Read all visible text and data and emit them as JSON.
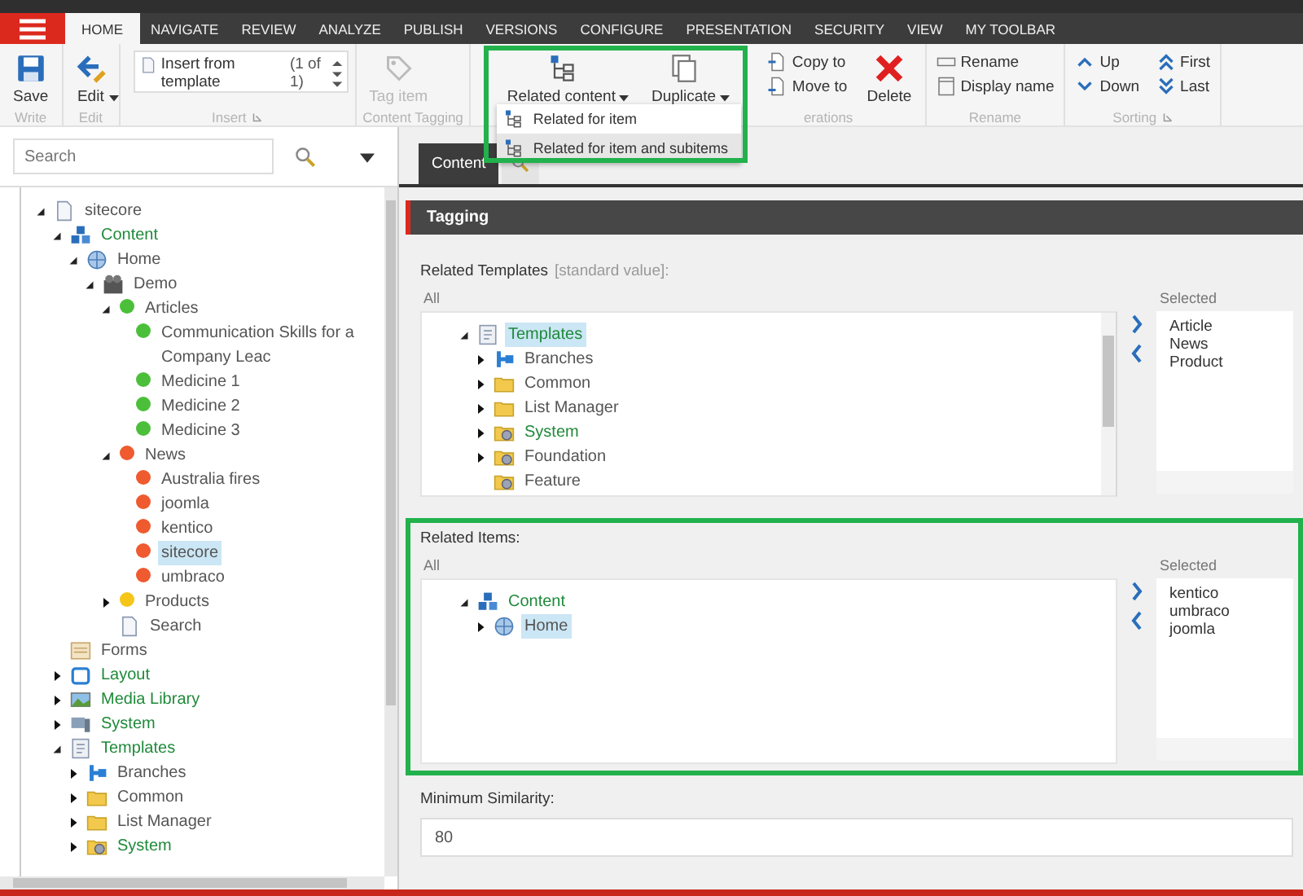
{
  "ribbon_tabs": [
    {
      "label": "HOME",
      "selected": true
    },
    {
      "label": "NAVIGATE",
      "selected": false
    },
    {
      "label": "REVIEW",
      "selected": false
    },
    {
      "label": "ANALYZE",
      "selected": false
    },
    {
      "label": "PUBLISH",
      "selected": false
    },
    {
      "label": "VERSIONS",
      "selected": false
    },
    {
      "label": "CONFIGURE",
      "selected": false
    },
    {
      "label": "PRESENTATION",
      "selected": false
    },
    {
      "label": "SECURITY",
      "selected": false
    },
    {
      "label": "VIEW",
      "selected": false
    },
    {
      "label": "MY TOOLBAR",
      "selected": false
    }
  ],
  "ribbon_groups": [
    {
      "label": "Write",
      "launcher": false,
      "items": [
        {
          "kind": "large",
          "label": "Save",
          "dropdown": false,
          "disabled": false
        }
      ]
    },
    {
      "label": "Edit",
      "launcher": false,
      "items": [
        {
          "kind": "large",
          "label": "Edit",
          "dropdown": true,
          "disabled": false
        }
      ]
    },
    {
      "label": "Insert",
      "launcher": true,
      "items": [
        {
          "kind": "gallery",
          "label": "Insert from template",
          "count": "(1 of 1)"
        }
      ]
    },
    {
      "label": "Content Tagging",
      "launcher": false,
      "items": [
        {
          "kind": "large",
          "label": "Tag item",
          "dropdown": false,
          "disabled": true
        }
      ]
    },
    {
      "label": "erations",
      "launcher": false,
      "items": [
        {
          "kind": "frame",
          "highlighted": true,
          "items": [
            {
              "kind": "large",
              "label": "Related content",
              "dropdown": true,
              "disabled": false
            },
            {
              "kind": "large",
              "label": "Duplicate",
              "dropdown": true,
              "disabled": false
            }
          ],
          "menu": [
            {
              "label": "Related for item",
              "hovered": false
            },
            {
              "label": "Related for item and subitems",
              "hovered": true
            }
          ]
        },
        {
          "kind": "stack",
          "items": [
            {
              "label": "Copy to"
            },
            {
              "label": "Move to"
            }
          ]
        },
        {
          "kind": "large",
          "label": "Delete",
          "dropdown": false,
          "disabled": false
        }
      ]
    },
    {
      "label": "Rename",
      "launcher": false,
      "items": [
        {
          "kind": "stack",
          "items": [
            {
              "label": "Rename"
            },
            {
              "label": "Display name"
            }
          ]
        }
      ]
    },
    {
      "label": "Sorting",
      "launcher": true,
      "items": [
        {
          "kind": "stack",
          "items": [
            {
              "label": "Up"
            },
            {
              "label": "Down"
            }
          ]
        },
        {
          "kind": "stack",
          "items": [
            {
              "label": "First"
            },
            {
              "label": "Last"
            }
          ]
        }
      ]
    }
  ],
  "search": {
    "placeholder": "Search"
  },
  "tree": [
    {
      "label": "sitecore",
      "kind": "document",
      "expanded": true,
      "emphasis": false,
      "selected": false,
      "children": [
        {
          "label": "Content",
          "kind": "cubes",
          "expanded": true,
          "emphasis": true,
          "selected": false,
          "children": [
            {
              "label": "Home",
              "kind": "globe",
              "expanded": true,
              "emphasis": false,
              "selected": false,
              "children": [
                {
                  "label": "Demo",
                  "kind": "camera",
                  "expanded": true,
                  "emphasis": false,
                  "selected": false,
                  "children": [
                    {
                      "label": "Articles",
                      "kind": "dot",
                      "color": "#4cbf3a",
                      "expanded": true,
                      "emphasis": false,
                      "selected": false,
                      "children": [
                        {
                          "label": "Communication Skills for a Company Leac",
                          "kind": "dot",
                          "color": "#4cbf3a",
                          "emphasis": false,
                          "selected": false
                        },
                        {
                          "label": "Medicine 1",
                          "kind": "dot",
                          "color": "#4cbf3a",
                          "emphasis": false,
                          "selected": false
                        },
                        {
                          "label": "Medicine 2",
                          "kind": "dot",
                          "color": "#4cbf3a",
                          "emphasis": false,
                          "selected": false
                        },
                        {
                          "label": "Medicine 3",
                          "kind": "dot",
                          "color": "#4cbf3a",
                          "emphasis": false,
                          "selected": false
                        }
                      ]
                    },
                    {
                      "label": "News",
                      "kind": "dot",
                      "color": "#ef5a2f",
                      "expanded": true,
                      "emphasis": false,
                      "selected": false,
                      "children": [
                        {
                          "label": "Australia fires",
                          "kind": "dot",
                          "color": "#ef5a2f",
                          "emphasis": false,
                          "selected": false
                        },
                        {
                          "label": "joomla",
                          "kind": "dot",
                          "color": "#ef5a2f",
                          "emphasis": false,
                          "selected": false
                        },
                        {
                          "label": "kentico",
                          "kind": "dot",
                          "color": "#ef5a2f",
                          "emphasis": false,
                          "selected": false
                        },
                        {
                          "label": "sitecore",
                          "kind": "dot",
                          "color": "#ef5a2f",
                          "emphasis": false,
                          "selected": true
                        },
                        {
                          "label": "umbraco",
                          "kind": "dot",
                          "color": "#ef5a2f",
                          "emphasis": false,
                          "selected": false
                        }
                      ]
                    },
                    {
                      "label": "Products",
                      "kind": "dot",
                      "color": "#f5c518",
                      "expanded": false,
                      "emphasis": false,
                      "selected": false
                    },
                    {
                      "label": "Search",
                      "kind": "document",
                      "emphasis": false,
                      "selected": false
                    }
                  ]
                }
              ]
            }
          ]
        },
        {
          "label": "Forms",
          "kind": "forms",
          "emphasis": false,
          "selected": false
        },
        {
          "label": "Layout",
          "kind": "window",
          "expanded": false,
          "emphasis": true,
          "selected": false
        },
        {
          "label": "Media Library",
          "kind": "picture",
          "expanded": false,
          "emphasis": true,
          "selected": false
        },
        {
          "label": "System",
          "kind": "computer",
          "expanded": false,
          "emphasis": true,
          "selected": false
        },
        {
          "label": "Templates",
          "kind": "templates",
          "expanded": true,
          "emphasis": true,
          "selected": false,
          "children": [
            {
              "label": "Branches",
              "kind": "branches",
              "expanded": false,
              "emphasis": false,
              "selected": false
            },
            {
              "label": "Common",
              "kind": "folder",
              "expanded": false,
              "emphasis": false,
              "selected": false
            },
            {
              "label": "List Manager",
              "kind": "folder",
              "expanded": false,
              "emphasis": false,
              "selected": false
            },
            {
              "label": "System",
              "kind": "gearfolder",
              "expanded": false,
              "emphasis": true,
              "selected": false
            }
          ]
        }
      ]
    }
  ],
  "editor_tabs": [
    {
      "kind": "text",
      "label": "Content",
      "selected": true
    },
    {
      "kind": "search",
      "selected": false
    }
  ],
  "section": {
    "title": "Tagging",
    "fields": [
      {
        "kind": "treelist",
        "label": "Related Templates",
        "note": "[standard value]:",
        "highlighted": false,
        "all_label": "All",
        "selected_label": "Selected",
        "scrollable": true,
        "tree": [
          {
            "label": "Templates",
            "kind": "templates",
            "expanded": true,
            "emphasis": true,
            "selected": true,
            "children": [
              {
                "label": "Branches",
                "kind": "branches",
                "expanded": false,
                "emphasis": false,
                "selected": false
              },
              {
                "label": "Common",
                "kind": "folder",
                "expanded": false,
                "emphasis": false,
                "selected": false
              },
              {
                "label": "List Manager",
                "kind": "folder",
                "expanded": false,
                "emphasis": false,
                "selected": false
              },
              {
                "label": "System",
                "kind": "gearfolder",
                "expanded": false,
                "emphasis": true,
                "selected": false
              },
              {
                "label": "Foundation",
                "kind": "gearfolder",
                "expanded": false,
                "emphasis": false,
                "selected": false
              },
              {
                "label": "Feature",
                "kind": "gearfolder",
                "emphasis": false,
                "selected": false
              }
            ]
          }
        ],
        "selected_items": [
          "Article",
          "News",
          "Product"
        ]
      },
      {
        "kind": "treelist",
        "label": "Related Items:",
        "highlighted": true,
        "all_label": "All",
        "selected_label": "Selected",
        "scrollable": false,
        "tree": [
          {
            "label": "Content",
            "kind": "cubes",
            "expanded": true,
            "emphasis": true,
            "selected": false,
            "children": [
              {
                "label": "Home",
                "kind": "globe",
                "expanded": false,
                "emphasis": false,
                "selected": true
              }
            ]
          }
        ],
        "selected_items": [
          "kentico",
          "umbraco",
          "joomla"
        ]
      },
      {
        "kind": "text",
        "label": "Minimum Similarity:",
        "value": "80"
      }
    ]
  }
}
